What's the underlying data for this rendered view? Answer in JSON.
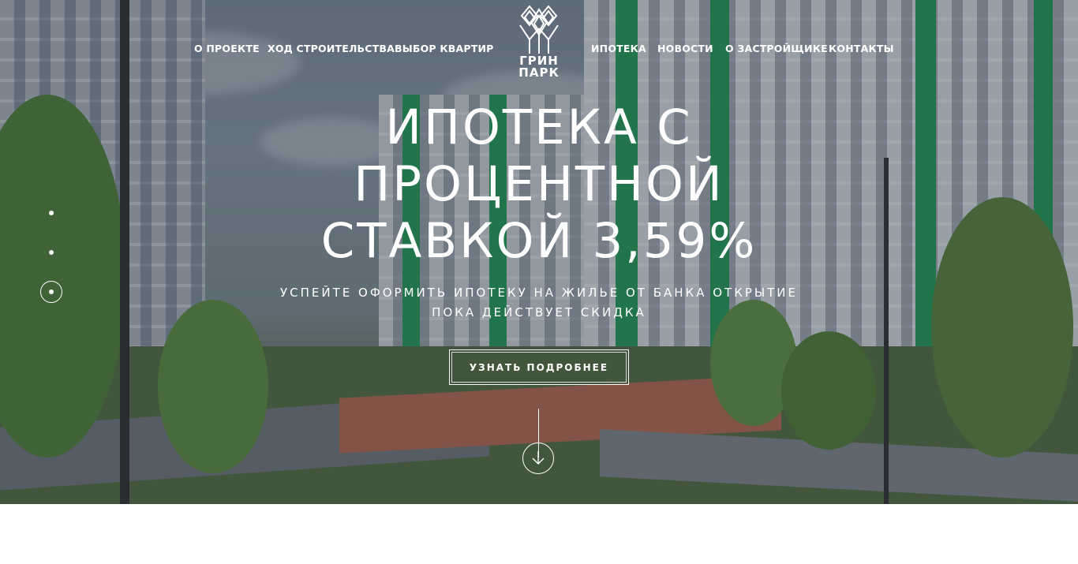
{
  "nav": {
    "left": [
      "О ПРОЕКТЕ",
      "ХОД СТРОИТЕЛЬСТВА",
      "ВЫБОР КВАРТИР"
    ],
    "right": [
      "ИПОТЕКА",
      "НОВОСТИ",
      "О ЗАСТРОЙЩИКЕ",
      "КОНТАКТЫ"
    ]
  },
  "logo": {
    "line1": "ГРИН",
    "line2": "ПАРК",
    "icon": "trees-logo-icon"
  },
  "hero": {
    "title_lines": [
      "ИПОТЕКА С",
      "ПРОЦЕНТНОЙ",
      "СТАВКОЙ 3,59%"
    ],
    "subtitle_lines": [
      "УСПЕЙТЕ ОФОРМИТЬ ИПОТЕКУ НА ЖИЛЬЕ ОТ БАНКА ОТКРЫТИЕ",
      "ПОКА ДЕЙСТВУЕТ СКИДКА"
    ],
    "cta_label": "УЗНАТЬ ПОДРОБНЕЕ"
  },
  "slider": {
    "total": 3,
    "active": 3
  },
  "icons": {
    "scroll": "arrow-down-icon"
  },
  "colors": {
    "brand_green": "#1f9a52",
    "text": "#ffffff"
  }
}
